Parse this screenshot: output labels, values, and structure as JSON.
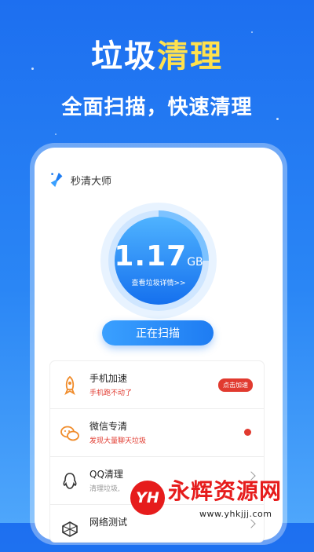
{
  "headline": {
    "part1": "垃圾",
    "part2": "清理"
  },
  "subline": "全面扫描，快速清理",
  "app": {
    "name": "秒清大师"
  },
  "gauge": {
    "value": "1.17",
    "unit": "GB",
    "link": "查看垃圾详情>>",
    "progress": 0.25
  },
  "scan_button": "正在扫描",
  "features": [
    {
      "id": "boost",
      "icon": "rocket-icon",
      "title": "手机加速",
      "desc": "手机跑不动了",
      "desc_color": "#e13a2f",
      "action": "badge",
      "action_label": "点击加速"
    },
    {
      "id": "wechat",
      "icon": "wechat-icon",
      "title": "微信专清",
      "desc": "发现大量聊天垃圾",
      "desc_color": "#e13a2f",
      "action": "dot"
    },
    {
      "id": "qq",
      "icon": "qq-icon",
      "title": "QQ清理",
      "desc": "清理垃圾,",
      "desc_color": "#999999",
      "action": "chevron"
    },
    {
      "id": "network",
      "icon": "network-icon",
      "title": "网络测试",
      "desc": "",
      "desc_color": "#999999",
      "action": "chevron"
    }
  ],
  "watermark": {
    "logo": "YH",
    "title": "永辉资源网",
    "url": "www.yhkjjj.com"
  },
  "colors": {
    "brand_blue": "#1e7cf2",
    "accent_yellow": "#ffe14d",
    "alert_red": "#e13a2f"
  }
}
